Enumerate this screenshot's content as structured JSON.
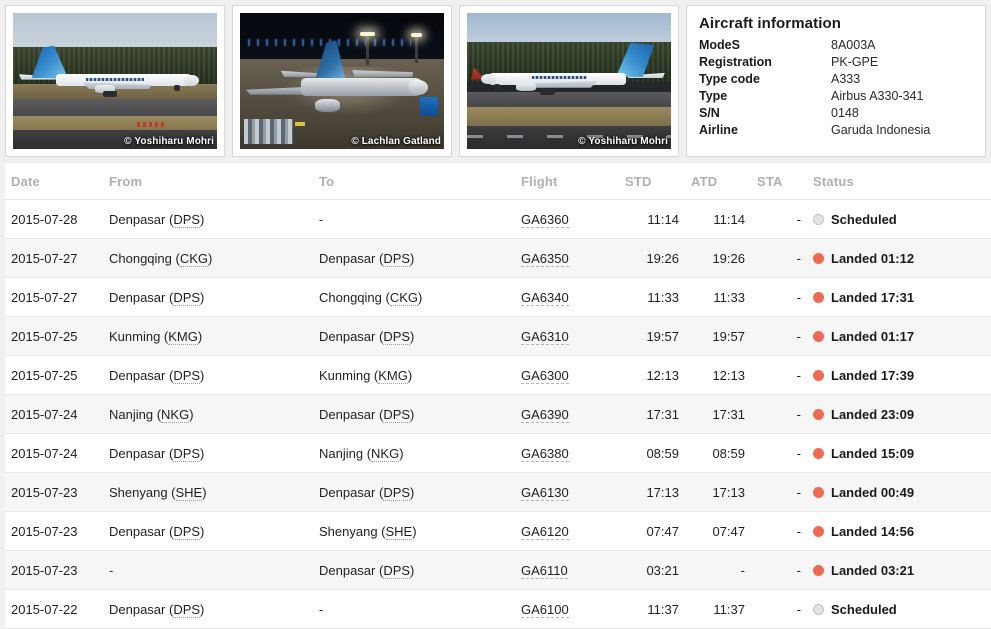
{
  "photos": [
    {
      "credit": "© Yoshiharu Mohri",
      "scene": "garuda-indonesia-a330-daylight-taxiway-left"
    },
    {
      "credit": "© Lachlan Gatland",
      "scene": "garuda-indonesia-a330-night-apron"
    },
    {
      "credit": "© Yoshiharu Mohri",
      "scene": "garuda-indonesia-a330-daylight-taxiway-right"
    }
  ],
  "aircraft_info": {
    "title": "Aircraft information",
    "rows": [
      {
        "label": "ModeS",
        "value": "8A003A"
      },
      {
        "label": "Registration",
        "value": "PK-GPE"
      },
      {
        "label": "Type code",
        "value": "A333"
      },
      {
        "label": "Type",
        "value": "Airbus A330-341"
      },
      {
        "label": "S/N",
        "value": "0148"
      },
      {
        "label": "Airline",
        "value": "Garuda Indonesia"
      }
    ]
  },
  "flights_table": {
    "headers": {
      "date": "Date",
      "from": "From",
      "to": "To",
      "flight": "Flight",
      "std": "STD",
      "atd": "ATD",
      "sta": "STA",
      "status": "Status",
      "action": ""
    },
    "colors": {
      "landed_dot": "#ef6a52",
      "scheduled_dot": "#e3e3e3",
      "header_text": "#b0b0b0"
    },
    "rows": [
      {
        "date": "2015-07-28",
        "from_city": "Denpasar",
        "from_code": "DPS",
        "to_city": "-",
        "to_code": "",
        "flight": "GA6360",
        "std": "11:14",
        "atd": "11:14",
        "sta": "-",
        "status": "Scheduled",
        "status_type": "scheduled",
        "action_icon": "airplane-icon"
      },
      {
        "date": "2015-07-27",
        "from_city": "Chongqing",
        "from_code": "CKG",
        "to_city": "Denpasar",
        "to_code": "DPS",
        "flight": "GA6350",
        "std": "19:26",
        "atd": "19:26",
        "sta": "-",
        "status": "Landed 01:12",
        "status_type": "landed",
        "action_icon": "airplane-icon"
      },
      {
        "date": "2015-07-27",
        "from_city": "Denpasar",
        "from_code": "DPS",
        "to_city": "Chongqing",
        "to_code": "CKG",
        "flight": "GA6340",
        "std": "11:33",
        "atd": "11:33",
        "sta": "-",
        "status": "Landed 17:31",
        "status_type": "landed",
        "action_icon": "airplane-icon"
      },
      {
        "date": "2015-07-25",
        "from_city": "Kunming",
        "from_code": "KMG",
        "to_city": "Denpasar",
        "to_code": "DPS",
        "flight": "GA6310",
        "std": "19:57",
        "atd": "19:57",
        "sta": "-",
        "status": "Landed 01:17",
        "status_type": "landed",
        "action_icon": "airplane-icon"
      },
      {
        "date": "2015-07-25",
        "from_city": "Denpasar",
        "from_code": "DPS",
        "to_city": "Kunming",
        "to_code": "KMG",
        "flight": "GA6300",
        "std": "12:13",
        "atd": "12:13",
        "sta": "-",
        "status": "Landed 17:39",
        "status_type": "landed",
        "action_icon": "airplane-icon"
      },
      {
        "date": "2015-07-24",
        "from_city": "Nanjing",
        "from_code": "NKG",
        "to_city": "Denpasar",
        "to_code": "DPS",
        "flight": "GA6390",
        "std": "17:31",
        "atd": "17:31",
        "sta": "-",
        "status": "Landed 23:09",
        "status_type": "landed",
        "action_icon": "airplane-icon"
      },
      {
        "date": "2015-07-24",
        "from_city": "Denpasar",
        "from_code": "DPS",
        "to_city": "Nanjing",
        "to_code": "NKG",
        "flight": "GA6380",
        "std": "08:59",
        "atd": "08:59",
        "sta": "-",
        "status": "Landed 15:09",
        "status_type": "landed",
        "action_icon": "airplane-icon"
      },
      {
        "date": "2015-07-23",
        "from_city": "Shenyang",
        "from_code": "SHE",
        "to_city": "Denpasar",
        "to_code": "DPS",
        "flight": "GA6130",
        "std": "17:13",
        "atd": "17:13",
        "sta": "-",
        "status": "Landed 00:49",
        "status_type": "landed",
        "action_icon": "airplane-icon"
      },
      {
        "date": "2015-07-23",
        "from_city": "Denpasar",
        "from_code": "DPS",
        "to_city": "Shenyang",
        "to_code": "SHE",
        "flight": "GA6120",
        "std": "07:47",
        "atd": "07:47",
        "sta": "-",
        "status": "Landed 14:56",
        "status_type": "landed",
        "action_icon": "airplane-icon"
      },
      {
        "date": "2015-07-23",
        "from_city": "-",
        "from_code": "",
        "to_city": "Denpasar",
        "to_code": "DPS",
        "flight": "GA6110",
        "std": "03:21",
        "atd": "-",
        "sta": "-",
        "status": "Landed 03:21",
        "status_type": "landed",
        "action_icon": "airplane-icon"
      },
      {
        "date": "2015-07-22",
        "from_city": "Denpasar",
        "from_code": "DPS",
        "to_city": "-",
        "to_code": "",
        "flight": "GA6100",
        "std": "11:37",
        "atd": "11:37",
        "sta": "-",
        "status": "Scheduled",
        "status_type": "scheduled",
        "action_icon": "airplane-icon"
      }
    ]
  }
}
